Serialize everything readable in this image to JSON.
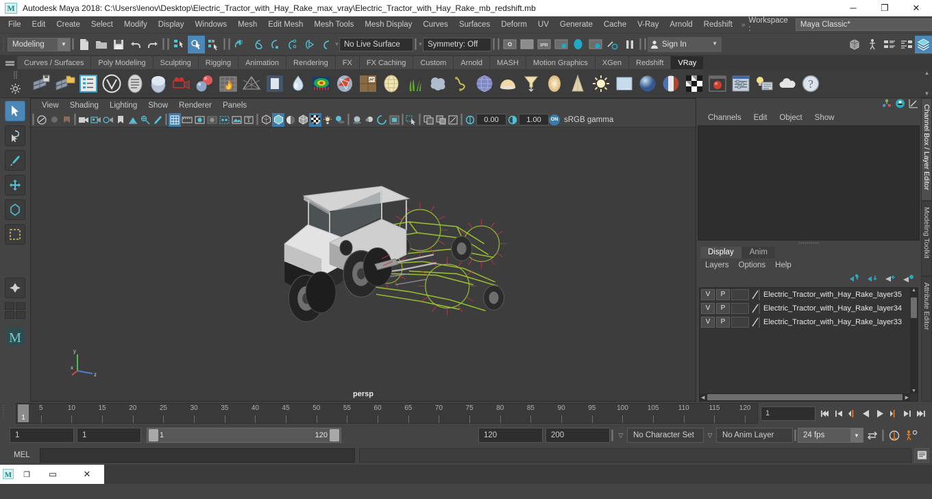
{
  "window": {
    "title": "Autodesk Maya 2018: C:\\Users\\lenov\\Desktop\\Electric_Tractor_with_Hay_Rake_max_vray\\Electric_Tractor_with_Hay_Rake_mb_redshift.mb",
    "logo": "M",
    "minimize": "─",
    "maximize": "❐",
    "close": "✕"
  },
  "menubar": {
    "items": [
      "File",
      "Edit",
      "Create",
      "Select",
      "Modify",
      "Display",
      "Windows",
      "Mesh",
      "Edit Mesh",
      "Mesh Tools",
      "Mesh Display",
      "Curves",
      "Surfaces",
      "Deform",
      "UV",
      "Generate",
      "Cache",
      "V-Ray",
      "Arnold",
      "Redshift"
    ],
    "overflow_chevron": "»",
    "workspace_label": "Workspace :",
    "workspace_value": "Maya Classic*",
    "workspace_arrow": "▼"
  },
  "statusbar": {
    "mode_value": "Modeling",
    "mode_arrow": "▼",
    "live_surface": "No Live Surface",
    "symmetry": "Symmetry: Off",
    "sign_in": "Sign In",
    "sign_in_arrow": "▼",
    "chevron": "▼"
  },
  "shelf": {
    "tabs": [
      "Curves / Surfaces",
      "Poly Modeling",
      "Sculpting",
      "Rigging",
      "Animation",
      "Rendering",
      "FX",
      "FX Caching",
      "Custom",
      "Arnold",
      "MASH",
      "Motion Graphics",
      "XGen",
      "Redshift",
      "VRay"
    ],
    "active_tab": "VRay",
    "up_arrow": "▲",
    "down_arrow": "▼"
  },
  "viewport_panel": {
    "menus": [
      "View",
      "Shading",
      "Lighting",
      "Show",
      "Renderer",
      "Panels"
    ],
    "exposure": "0.00",
    "gamma": "1.00",
    "color_management_badge": "ON",
    "color_management": "sRGB gamma",
    "camera_label": "persp",
    "axis": {
      "x": "x",
      "y": "y",
      "z": "z"
    }
  },
  "channel_box": {
    "menus": [
      "Channels",
      "Edit",
      "Object",
      "Show"
    ]
  },
  "layer_editor": {
    "tabs": [
      "Display",
      "Anim"
    ],
    "active_tab": "Display",
    "menus": [
      "Layers",
      "Options",
      "Help"
    ],
    "rows": [
      {
        "visible": "V",
        "playback": "P",
        "name": "Electric_Tractor_with_Hay_Rake_layer35"
      },
      {
        "visible": "V",
        "playback": "P",
        "name": "Electric_Tractor_with_Hay_Rake_layer34"
      },
      {
        "visible": "V",
        "playback": "P",
        "name": "Electric_Tractor_with_Hay_Rake_layer33"
      }
    ]
  },
  "side_tabs": [
    "Channel Box / Layer Editor",
    "Modeling Toolkit",
    "Attribute Editor"
  ],
  "timeline": {
    "ticks": [
      5,
      10,
      15,
      20,
      25,
      30,
      35,
      40,
      45,
      50,
      55,
      60,
      65,
      70,
      75,
      80,
      85,
      90,
      95,
      100,
      105,
      110,
      115,
      120
    ],
    "current_frame": "1",
    "frame_field": "1",
    "playback_buttons": [
      "⏮",
      "◀❘",
      "❘◀",
      "◀",
      "▶",
      "▶❘",
      "❘▶",
      "⏭"
    ]
  },
  "range": {
    "start": "1",
    "anim_start": "1",
    "slider_start": "1",
    "slider_end": "120",
    "anim_end": "120",
    "end": "200",
    "character_set": "No Character Set",
    "anim_layer": "No Anim Layer",
    "fps": "24 fps",
    "chevron": "▽",
    "arrow": "▼"
  },
  "command_line": {
    "language": "MEL",
    "input_value": "",
    "output_value": ""
  },
  "taskbar": {
    "app_icon": "M",
    "restore": "▭",
    "close": "✕",
    "copy": "❐"
  },
  "colors": {
    "accent_blue": "#4b88b7",
    "panel_bg": "#444444",
    "viewport_bg": "#3d3d3d",
    "text": "#c8c8c8",
    "highlight": "#00b3c8",
    "orange": "#e07b20"
  }
}
